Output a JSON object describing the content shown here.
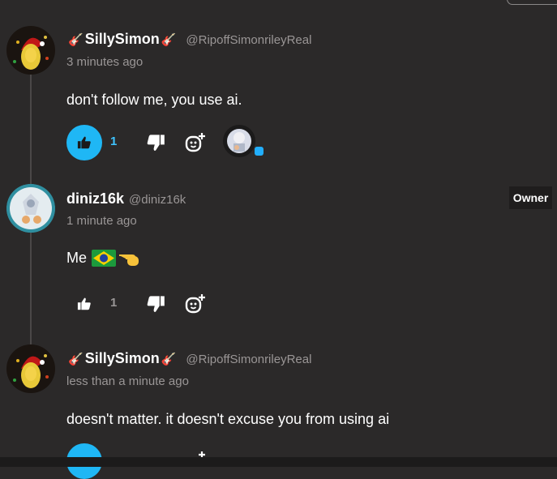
{
  "comments": [
    {
      "display_name": "SillySimon",
      "emoji_left": "🎸",
      "emoji_right": "🎸",
      "handle": "@RipoffSimonrileyReal",
      "time": "3 minutes ago",
      "text": "don't follow me, you use ai.",
      "likes": "1",
      "liked": true
    },
    {
      "display_name": "diniz16k",
      "handle": "@diniz16k",
      "time": "1 minute ago",
      "text": "Me",
      "likes": "1",
      "liked": false,
      "badge": "Owner"
    },
    {
      "display_name": "SillySimon",
      "emoji_left": "🎸",
      "emoji_right": "🎸",
      "handle": "@RipoffSimonrileyReal",
      "time": "less than a minute ago",
      "text": "doesn't matter. it doesn't excuse you from using ai",
      "liked": true
    }
  ],
  "icons": {
    "like": "thumbs-up-icon",
    "dislike": "thumbs-down-icon",
    "reply": "reply-icon"
  },
  "colors": {
    "background": "#2b2929",
    "accent": "#1fb7f5",
    "muted_text": "#9a9696"
  }
}
